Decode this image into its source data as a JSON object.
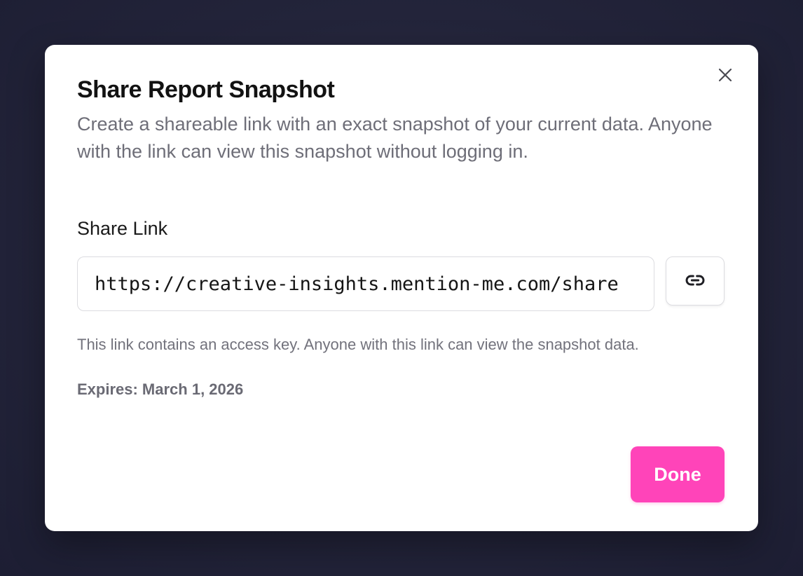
{
  "dialog": {
    "title": "Share Report Snapshot",
    "description": "Create a shareable link with an exact snapshot of your current data. Anyone with the link can view this snapshot without logging in.",
    "close_icon": "close-icon"
  },
  "share_link": {
    "label": "Share Link",
    "value": "https://creative-insights.mention-me.com/share",
    "copy_icon": "link-icon",
    "helper_text": "This link contains an access key. Anyone with this link can view the snapshot data.",
    "expires_text": "Expires: March 1, 2026"
  },
  "actions": {
    "done_label": "Done"
  },
  "colors": {
    "accent": "#ff44b9",
    "backdrop": "#23243a",
    "title_text": "#121212",
    "muted_text": "#6e6e78"
  }
}
